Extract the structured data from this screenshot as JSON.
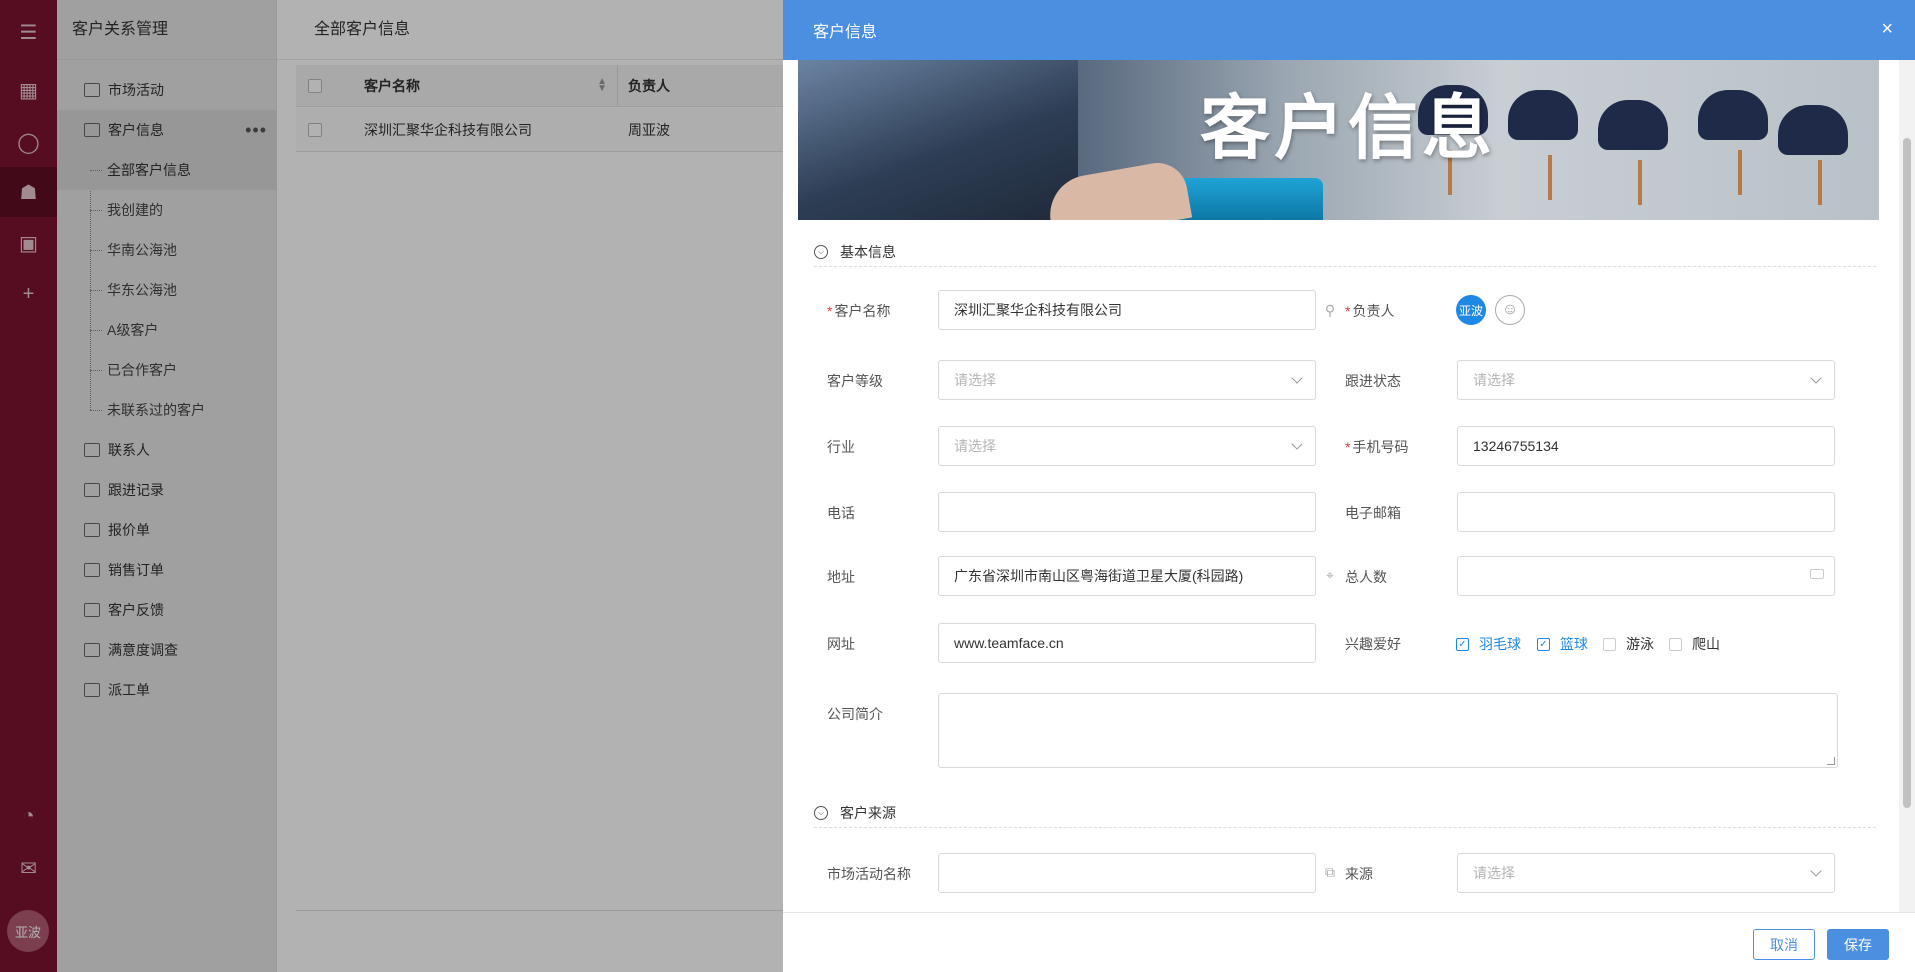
{
  "app": {
    "title": "客户关系管理"
  },
  "rail": {
    "icons": [
      "menu-icon",
      "dashboard-icon",
      "chat-icon",
      "crm-icon",
      "apps-icon",
      "add-icon",
      "chart-pie-icon",
      "mail-icon"
    ],
    "avatar": "亚波"
  },
  "nav": {
    "items": [
      {
        "label": "市场活动"
      },
      {
        "label": "客户信息"
      },
      {
        "label": "联系人"
      },
      {
        "label": "跟进记录"
      },
      {
        "label": "报价单"
      },
      {
        "label": "销售订单"
      },
      {
        "label": "客户反馈"
      },
      {
        "label": "满意度调查"
      },
      {
        "label": "派工单"
      }
    ],
    "sub_items": [
      {
        "label": "全部客户信息"
      },
      {
        "label": "我创建的"
      },
      {
        "label": "华南公海池"
      },
      {
        "label": "华东公海池"
      },
      {
        "label": "A级客户"
      },
      {
        "label": "已合作客户"
      },
      {
        "label": "未联系过的客户"
      }
    ]
  },
  "list": {
    "title": "全部客户信息",
    "columns": [
      "客户名称",
      "负责人"
    ],
    "rows": [
      {
        "name": "深圳汇聚华企科技有限公司",
        "owner": "周亚波"
      }
    ]
  },
  "drawer": {
    "title": "客户信息",
    "close": "×",
    "banner_title": "客户信息",
    "sections": {
      "basic": "基本信息",
      "source": "客户来源"
    },
    "fields": {
      "customer_name": {
        "label": "客户名称",
        "value": "深圳汇聚华企科技有限公司"
      },
      "owner": {
        "label": "负责人",
        "avatar": "亚波"
      },
      "level": {
        "label": "客户等级",
        "placeholder": "请选择"
      },
      "follow_status": {
        "label": "跟进状态",
        "placeholder": "请选择"
      },
      "industry": {
        "label": "行业",
        "placeholder": "请选择"
      },
      "mobile": {
        "label": "手机号码",
        "value": "13246755134"
      },
      "phone": {
        "label": "电话",
        "value": ""
      },
      "email": {
        "label": "电子邮箱",
        "value": ""
      },
      "address": {
        "label": "地址",
        "value": "广东省深圳市南山区粤海街道卫星大厦(科园路)"
      },
      "headcount": {
        "label": "总人数",
        "value": ""
      },
      "website": {
        "label": "网址",
        "value": "www.teamface.cn"
      },
      "hobbies": {
        "label": "兴趣爱好",
        "options": [
          {
            "label": "羽毛球",
            "checked": true
          },
          {
            "label": "篮球",
            "checked": true
          },
          {
            "label": "游泳",
            "checked": false
          },
          {
            "label": "爬山",
            "checked": false
          }
        ]
      },
      "intro": {
        "label": "公司简介",
        "value": ""
      },
      "campaign": {
        "label": "市场活动名称",
        "value": ""
      },
      "source": {
        "label": "来源",
        "placeholder": "请选择"
      }
    },
    "buttons": {
      "cancel": "取消",
      "save": "保存"
    }
  },
  "colors": {
    "rail": "#7c1431",
    "accent": "#4a8fe0",
    "required": "#e0403b",
    "checked": "#1e88e5"
  }
}
